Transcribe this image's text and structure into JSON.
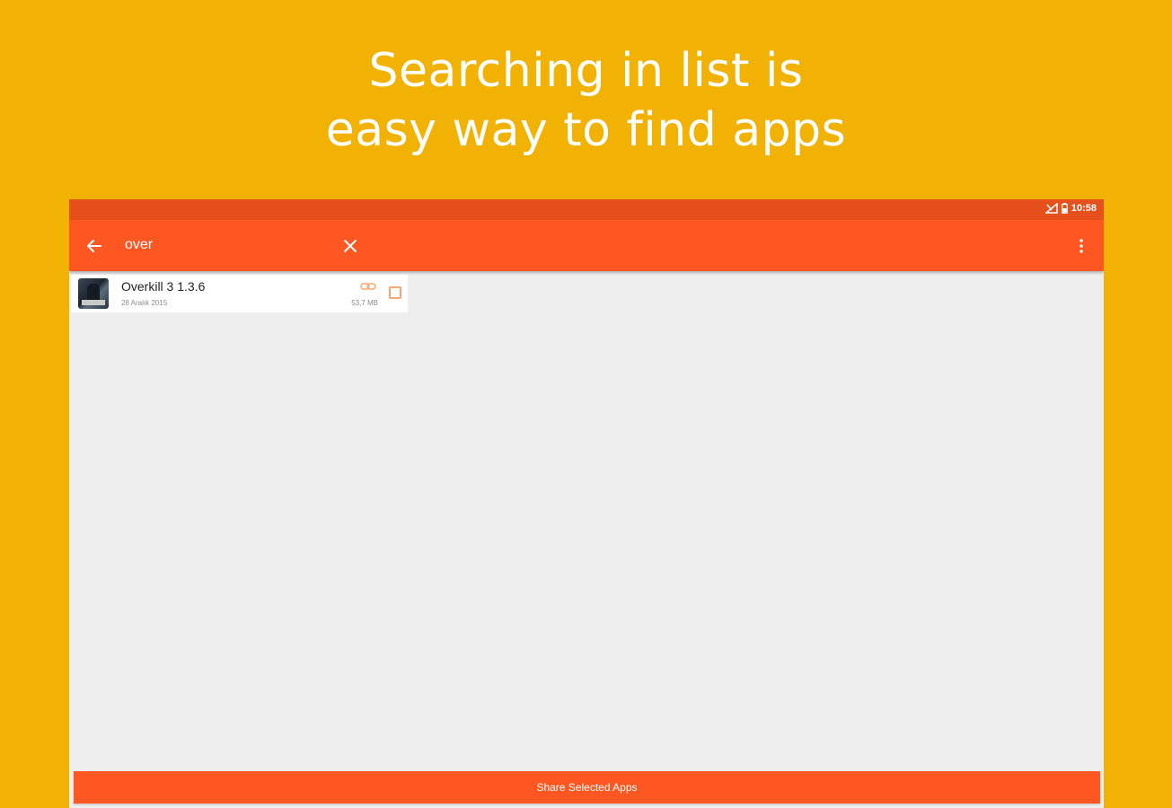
{
  "headline": {
    "line1": "Searching in list is",
    "line2": "easy way to find apps"
  },
  "status_bar": {
    "time": "10:58",
    "icons": [
      "signal-icon",
      "battery-icon"
    ]
  },
  "toolbar": {
    "back_icon": "arrow-back-icon",
    "search_value": "over",
    "clear_icon": "close-icon",
    "menu_icon": "overflow-menu-icon"
  },
  "results": [
    {
      "name": "Overkill 3 1.3.6",
      "date": "28 Aralık 2015",
      "size": "53,7 MB",
      "checked": false
    }
  ],
  "share_button": {
    "label": "Share Selected Apps"
  },
  "colors": {
    "background": "#F2B203",
    "status_bar": "#E5501C",
    "toolbar": "#FF5722",
    "content": "#EEEEEE",
    "accent_light": "#F7A56E"
  }
}
